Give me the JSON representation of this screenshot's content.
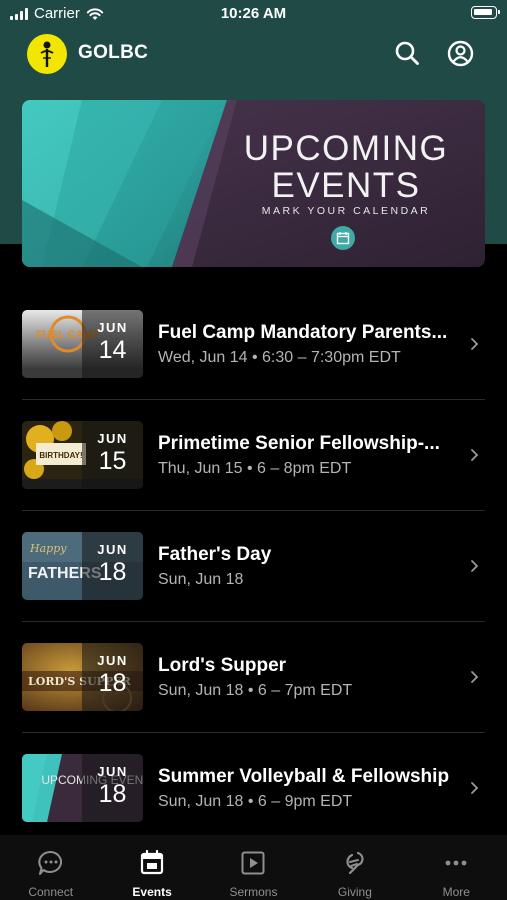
{
  "status_bar": {
    "carrier": "Carrier",
    "time": "10:26 AM"
  },
  "header": {
    "title": "GOLBC"
  },
  "banner": {
    "title_line1": "UPCOMING",
    "title_line2": "EVENTS",
    "subtitle": "MARK YOUR CALENDAR"
  },
  "events": [
    {
      "month": "JUN",
      "day": "14",
      "title": "Fuel Camp Mandatory Parents...",
      "details": "Wed, Jun 14 • 6:30 – 7:30pm EDT",
      "thumb_text": "FUEL CAMP"
    },
    {
      "month": "JUN",
      "day": "15",
      "title": "Primetime Senior Fellowship-...",
      "details": "Thu, Jun 15 • 6 – 8pm EDT",
      "thumb_text": "BIRTHDAY!"
    },
    {
      "month": "JUN",
      "day": "18",
      "title": "Father's Day",
      "details": "Sun, Jun 18",
      "thumb_text": "FATHERS"
    },
    {
      "month": "JUN",
      "day": "18",
      "title": "Lord's Supper",
      "details": "Sun, Jun 18 • 6 – 7pm EDT",
      "thumb_text": "LORD'S SUPPER"
    },
    {
      "month": "JUN",
      "day": "18",
      "title": "Summer Volleyball & Fellowship",
      "details": "Sun, Jun 18 • 6 – 9pm EDT",
      "thumb_text": "UPCOMING EVENTS"
    }
  ],
  "tabs": [
    {
      "label": "Connect",
      "icon": "chat-bubble-icon",
      "active": false
    },
    {
      "label": "Events",
      "icon": "calendar-icon",
      "active": true
    },
    {
      "label": "Sermons",
      "icon": "play-icon",
      "active": false
    },
    {
      "label": "Giving",
      "icon": "giving-icon",
      "active": false
    },
    {
      "label": "More",
      "icon": "more-dots-icon",
      "active": false
    }
  ],
  "colors": {
    "header_bg": "#1f4a46",
    "logo_yellow": "#f2e600",
    "background": "#000000",
    "muted_text": "#b4b4b4",
    "accent_teal": "#3fa9a6"
  }
}
